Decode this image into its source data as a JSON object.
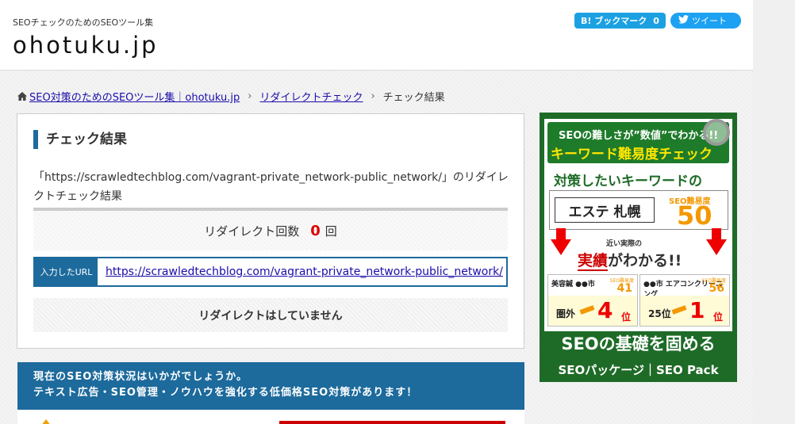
{
  "header": {
    "tagline": "SEOチェックのためのSEOツール集",
    "logo": "ohotuku.jp",
    "hatena_label": "B! ブックマーク",
    "hatena_count": "0",
    "tweet_label": "ツイート"
  },
  "breadcrumb": {
    "home": "SEO対策のためのSEOツール集｜ohotuku.jp",
    "parent": "リダイレクトチェック",
    "current": "チェック結果",
    "separator": "›"
  },
  "result": {
    "title": "チェック結果",
    "description": "「https://scrawledtechblog.com/vagrant-private_network-public_network/」のリダイレクトチェック結果",
    "count_label": "リダイレクト回数",
    "count_value": "0",
    "count_unit": "回",
    "url_label": "入力したURL",
    "url_value": "https://scrawledtechblog.com/vagrant-private_network-public_network/",
    "status": "リダイレクトはしていません"
  },
  "promo": {
    "line1": "現在のSEO対策状況はいかがでしょうか。",
    "line2": "テキスト広告・SEO管理・ノウハウを強化する低価格SEO対策があります！"
  },
  "ad": {
    "top_line1": "SEOの難しさが”数値”でわかる!!",
    "top_line2": "キーワード難易度チェック",
    "target": "対策したいキーワードの",
    "keyword": "エステ 札幌",
    "score_label": "SEO難易度",
    "score": "50",
    "near_label": "近い実際の",
    "results_em": "実績",
    "results_rest": "がわかる!!",
    "case_a_name": "美容鍼 ●●市",
    "case_a_score_label": "SEO難易度",
    "case_a_score": "41",
    "case_a_from": "圏外",
    "case_a_to": "4",
    "case_b_name": "●●市 エアコンクリーニング",
    "case_b_score_label": "SEO難易度",
    "case_b_score": "56",
    "case_b_from": "25位",
    "case_b_to": "1",
    "rank_unit": "位",
    "bottom1": "SEOの基礎を固める",
    "bottom2": "SEOパッケージ｜SEO Pack"
  }
}
